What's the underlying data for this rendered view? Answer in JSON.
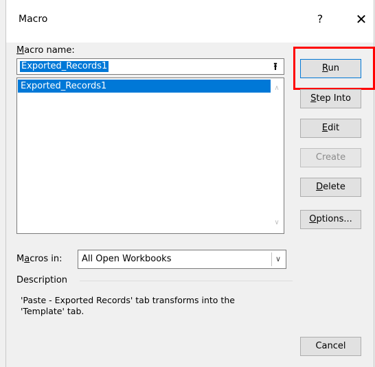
{
  "window": {
    "title": "Macro",
    "help_label": "?",
    "close_label": "✕"
  },
  "macro_name": {
    "label_prefix": "M",
    "label_rest": "acro name:",
    "value": "Exported_Records1",
    "upload_icon": "⭱"
  },
  "macro_list": {
    "items": [
      "Exported_Records1"
    ],
    "scroll_up": "∧",
    "scroll_down": "∨"
  },
  "buttons": {
    "run": {
      "u": "R",
      "rest": "un"
    },
    "step_into": {
      "u": "S",
      "rest": "tep Into"
    },
    "edit": {
      "u": "E",
      "rest": "dit"
    },
    "create": "Create",
    "delete": {
      "u": "D",
      "rest": "elete"
    },
    "options": {
      "u": "O",
      "rest": "ptions..."
    },
    "cancel": "Cancel"
  },
  "macros_in": {
    "label_pre": "M",
    "label_u": "a",
    "label_post": "cros in:",
    "value": "All Open Workbooks",
    "arrow": "∨"
  },
  "description": {
    "label": "Description",
    "text_line1": "'Paste - Exported Records' tab transforms into the",
    "text_line2": "'Template' tab."
  },
  "colors": {
    "selection": "#0078d7",
    "highlight_box": "#ff0000",
    "dialog_bg": "#f0f0f0"
  }
}
